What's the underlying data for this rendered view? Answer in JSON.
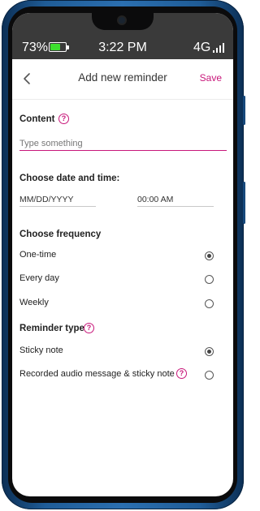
{
  "status": {
    "battery_percent": "73%",
    "battery_level": 0.73,
    "time": "3:22 PM",
    "network": "4G"
  },
  "appbar": {
    "title": "Add new reminder",
    "save_label": "Save",
    "back_icon": "chevron-left-icon"
  },
  "content": {
    "title": "Content",
    "placeholder": "Type something",
    "value": ""
  },
  "datetime": {
    "title": "Choose date and time:",
    "date_placeholder": "MM/DD/YYYY",
    "time_placeholder": "00:00 AM"
  },
  "frequency": {
    "title": "Choose frequency",
    "options": [
      {
        "label": "One-time",
        "selected": true
      },
      {
        "label": "Every day",
        "selected": false
      },
      {
        "label": "Weekly",
        "selected": false
      }
    ]
  },
  "reminder_type": {
    "title": "Reminder type",
    "options": [
      {
        "label": "Sticky note",
        "selected": true
      },
      {
        "label": "Recorded audio message & sticky note",
        "selected": false
      }
    ]
  },
  "colors": {
    "accent": "#c8177a",
    "statusbar": "#3a3a3a",
    "battery": "#3ee02f",
    "frame": "#2b6fb0"
  }
}
